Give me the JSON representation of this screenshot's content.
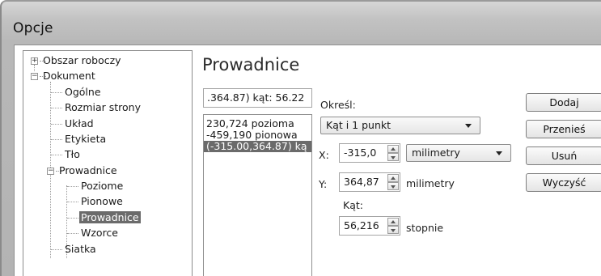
{
  "window": {
    "title": "Opcje"
  },
  "tree": {
    "items": [
      {
        "label": "Obszar roboczy",
        "expander": "+"
      },
      {
        "label": "Dokument",
        "expander": "−"
      },
      {
        "label": "Ogólne"
      },
      {
        "label": "Rozmiar strony"
      },
      {
        "label": "Układ"
      },
      {
        "label": "Etykieta"
      },
      {
        "label": "Tło"
      },
      {
        "label": "Prowadnice",
        "expander": "−"
      },
      {
        "label": "Poziome"
      },
      {
        "label": "Pionowe"
      },
      {
        "label": "Prowadnice",
        "selected": true
      },
      {
        "label": "Wzorce"
      },
      {
        "label": "Siatka"
      }
    ]
  },
  "panel": {
    "title": "Prowadnice",
    "guide_input": ".364.87) kąt: 56.22",
    "list": [
      "230,724 pozioma",
      "-459,190 pionowa",
      "(-315.00,364.87) ką"
    ],
    "list_selected_index": 2,
    "specify_label": "Określ:",
    "specify_value": "Kąt i 1 punkt",
    "x_label": "X:",
    "x_value": "-315,0",
    "x_unit": "milimetry",
    "y_label": "Y:",
    "y_value": "364,87",
    "y_unit": "milimetry",
    "angle_label": "Kąt:",
    "angle_value": "56,216",
    "angle_unit": "stopnie"
  },
  "buttons": {
    "add": "Dodaj",
    "move": "Przenieś",
    "delete": "Usuń",
    "clear": "Wyczyść"
  },
  "colors": {
    "selection": "#6b6b6b",
    "frame": "#b8b8b8"
  }
}
